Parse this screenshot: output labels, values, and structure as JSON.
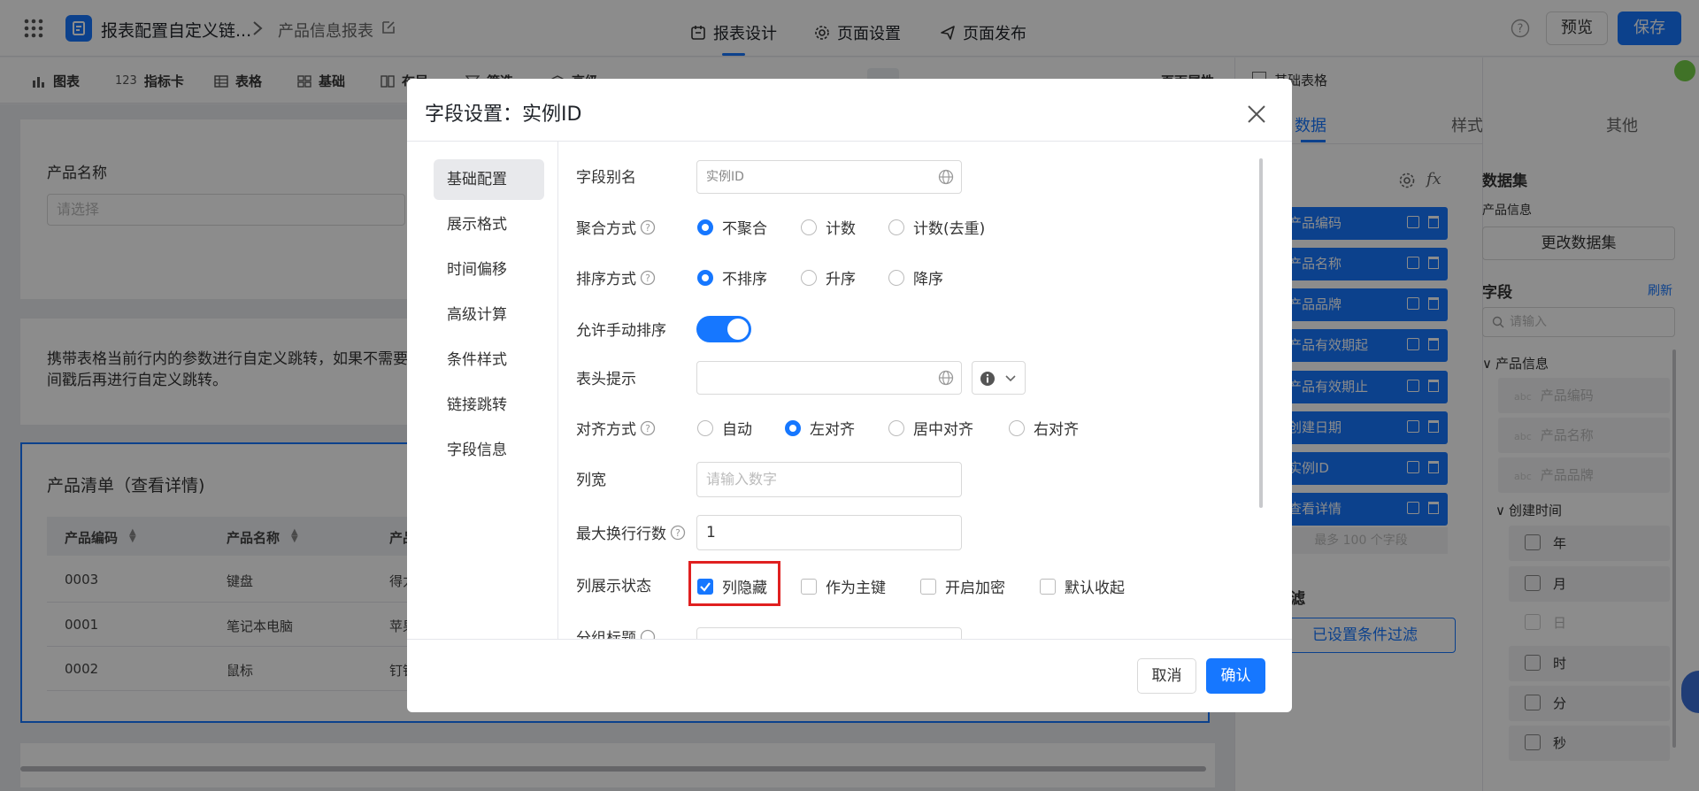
{
  "app": {
    "title": "报表配置自定义链...",
    "breadcrumb_page": "产品信息报表",
    "tabs": [
      "报表设计",
      "页面设置",
      "页面发布"
    ],
    "preview_label": "预览",
    "save_label": "保存"
  },
  "toolbar": {
    "items": [
      {
        "label": "图表",
        "icon": "bar-chart-icon"
      },
      {
        "label": "指标卡",
        "icon": "123"
      },
      {
        "label": "表格",
        "icon": "table-icon"
      },
      {
        "label": "基础",
        "icon": "grid-icon"
      },
      {
        "label": "布局",
        "icon": "columns-icon"
      },
      {
        "label": "筛选",
        "icon": "filter-icon"
      },
      {
        "label": "高级",
        "icon": "cube-icon"
      }
    ],
    "page_props_label": "页面属性"
  },
  "canvas": {
    "filter_label": "产品名称",
    "filter_placeholder": "请选择",
    "note_text": "携带表格当前行内的参数进行自定义跳转，如果不需要",
    "note_text_2": "间戳后再进行自定义跳转。",
    "table_title": "产品清单（查看详情)",
    "table_headers": [
      "产品编码",
      "产品名称",
      "产品"
    ],
    "table_rows": [
      [
        "0003",
        "键盘",
        "得力"
      ],
      [
        "0001",
        "笔记本电脑",
        "苹果"
      ],
      [
        "0002",
        "鼠标",
        "钉钉"
      ]
    ]
  },
  "right_panel": {
    "header": "基础表格",
    "tabs": [
      "数据",
      "样式",
      "其他"
    ],
    "fields": [
      "产品编码",
      "产品名称",
      "产品品牌",
      "产品有效期起",
      "产品有效期止",
      "创建日期",
      "实例ID",
      "查看详情"
    ],
    "field_limit": "最多 100 个字段",
    "filter_section": "滤",
    "filter_button": "已设置条件过滤",
    "dataset_title": "数据集",
    "dataset_name": "产品信息",
    "change_dataset": "更改数据集",
    "fields_title": "字段",
    "refresh": "刷新",
    "search_placeholder": "请输入",
    "tree_root": "产品信息",
    "tree_items": [
      "产品编码",
      "产品名称",
      "产品品牌"
    ],
    "tree_type_tag": "abc",
    "time_group": "创建时间",
    "time_items": [
      "年",
      "月",
      "日",
      "时",
      "分",
      "秒"
    ]
  },
  "modal": {
    "title": "字段设置：实例ID",
    "side_items": [
      "基础配置",
      "展示格式",
      "时间偏移",
      "高级计算",
      "条件样式",
      "链接跳转",
      "字段信息"
    ],
    "labels": {
      "alias": "字段别名",
      "agg": "聚合方式",
      "sort": "排序方式",
      "manual_sort": "允许手动排序",
      "header_tip": "表头提示",
      "align": "对齐方式",
      "width": "列宽",
      "max_lines": "最大换行行数",
      "display_state": "列展示状态",
      "group_title": "分组标题"
    },
    "alias_value": "实例ID",
    "agg_options": [
      "不聚合",
      "计数",
      "计数(去重)"
    ],
    "sort_options": [
      "不排序",
      "升序",
      "降序"
    ],
    "manual_sort_on": true,
    "align_options": [
      "自动",
      "左对齐",
      "居中对齐",
      "右对齐"
    ],
    "width_placeholder": "请输入数字",
    "max_lines_value": "1",
    "display_options": [
      "列隐藏",
      "作为主键",
      "开启加密",
      "默认收起"
    ],
    "cancel_label": "取消",
    "ok_label": "确认"
  },
  "colors": {
    "primary": "#1677ff",
    "highlight": "#e02020"
  }
}
